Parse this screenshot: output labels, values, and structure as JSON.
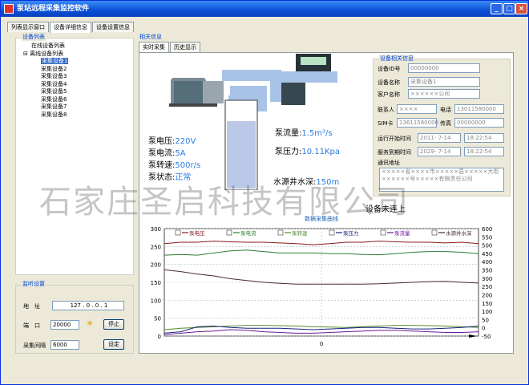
{
  "window": {
    "title": "泵站远程采集监控软件"
  },
  "main_tabs": [
    "列表显示窗口",
    "设备详细信息",
    "设备设置信息"
  ],
  "device_list": {
    "group": "设备列表",
    "online": "在线设备列表",
    "offline": "离线设备列表",
    "devices": [
      "采集设备1",
      "采集设备2",
      "采集设备3",
      "采集设备4",
      "采集设备5",
      "采集设备6",
      "采集设备7",
      "采集设备8"
    ]
  },
  "listen": {
    "group": "监听设置",
    "addr_label": "地　址",
    "ip": "127 . 0 . 0 . 1",
    "port_label": "端　口",
    "port": "20000",
    "stop": "停止",
    "interval_label": "采集间隔",
    "interval": "6000",
    "set": "设定"
  },
  "related": {
    "group": "相关信息",
    "tabs": [
      "实时采集",
      "历史显示"
    ]
  },
  "pump": {
    "voltage_label": "泵电压:",
    "voltage": "220V",
    "current_label": "泵电流:",
    "current": "5A",
    "speed_label": "泵转速:",
    "speed": "500r/s",
    "status_label": "泵状态:",
    "status": "正常",
    "flow_label": "泵流量:",
    "flow": "1.5m³/s",
    "pressure_label": "泵压力:",
    "pressure": "10.11Kpa",
    "depth_label": "水源井水深:",
    "depth": "150m"
  },
  "device_info": {
    "group": "设备相关信息",
    "id_label": "设备ID号",
    "id": "00000000",
    "name_label": "设备名称",
    "name": "采集设备1",
    "client_label": "客户名称",
    "client": "××××××公司",
    "contact_label": "联系人",
    "contact": "××××",
    "phone_label": "电话",
    "phone": "13011580000",
    "sim_label": "SIM卡",
    "sim": "13611580000",
    "fax_label": "传真",
    "fax": "00000000",
    "run_label": "运行开始时间",
    "run_date": "2011- 7-14",
    "run_time": "18:22:54",
    "due_label": "服务到期时间",
    "due_date": "2029- 7-14",
    "due_time": "18:22:54",
    "addr_label": "通讯地址",
    "addr": "×××××省××××市×××××县×××××大街××××××号×××××有限责任公司"
  },
  "watermark": "石家庄圣启科技有限公司",
  "chart_overlay": "设备未连上",
  "chart_data": {
    "type": "line",
    "title": "数据采集曲线",
    "ylim_left": [
      0,
      300
    ],
    "yticks_left": [
      0,
      50,
      100,
      150,
      200,
      250,
      300
    ],
    "ylim_right": [
      -50,
      600
    ],
    "yticks_right": [
      -50,
      0,
      50,
      100,
      150,
      200,
      250,
      300,
      350,
      400,
      450,
      500,
      550,
      600
    ],
    "xtick": "0",
    "series": [
      {
        "name": "泵电压",
        "color": "#8b1a1a",
        "values": [
          258,
          262,
          262,
          265,
          263,
          262,
          262,
          260,
          258,
          255,
          258,
          262,
          262,
          265,
          263,
          262,
          262,
          260,
          262,
          258
        ]
      },
      {
        "name": "泵电流",
        "color": "#2e7d32",
        "values": [
          226,
          228,
          226,
          232,
          238,
          240,
          236,
          232,
          232,
          232,
          230,
          230,
          228,
          227,
          230,
          234,
          236,
          236,
          234,
          230
        ]
      },
      {
        "name": "泵转速",
        "color": "#558b2f",
        "values": [
          18,
          22,
          24,
          26,
          28,
          30,
          30,
          29,
          28,
          26,
          25,
          24,
          26,
          28,
          30,
          30,
          29,
          28,
          26,
          24
        ]
      },
      {
        "name": "泵压力",
        "color": "#1a237e",
        "values": [
          8,
          12,
          26,
          28,
          24,
          22,
          22,
          22,
          20,
          18,
          20,
          22,
          24,
          24,
          22,
          20,
          20,
          22,
          24,
          28
        ]
      },
      {
        "name": "泵流量",
        "color": "#6a1b9a",
        "values": [
          4,
          8,
          12,
          14,
          18,
          16,
          12,
          10,
          8,
          8,
          10,
          12,
          14,
          16,
          16,
          14,
          12,
          10,
          10,
          12
        ]
      },
      {
        "name": "水源井水深",
        "color": "#4a2c2a",
        "values": [
          185,
          180,
          173,
          168,
          160,
          155,
          150,
          147,
          145,
          145,
          145,
          145,
          145,
          146,
          148,
          150,
          152,
          153,
          150,
          148
        ]
      }
    ]
  }
}
